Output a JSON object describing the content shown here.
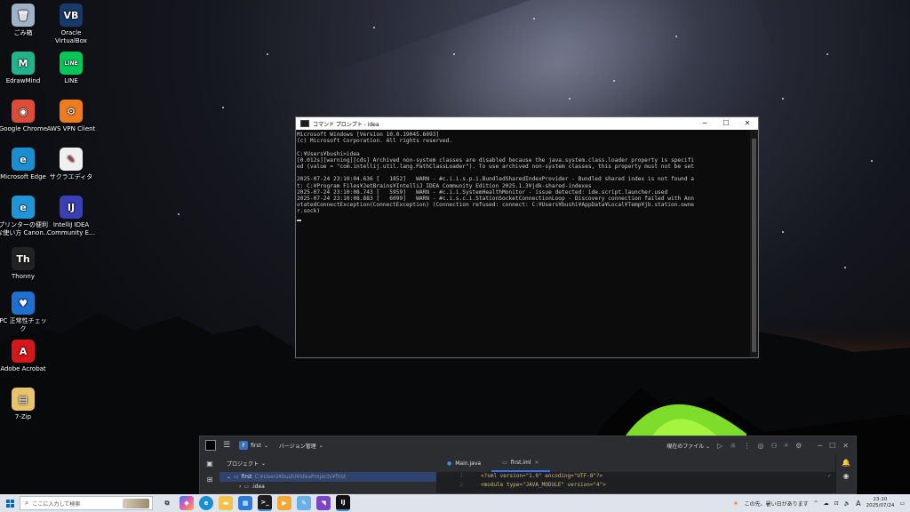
{
  "desktop_icons": [
    {
      "label": "ごみ箱",
      "color": "#9fb2c8",
      "glyph": "🗑"
    },
    {
      "label": "Oracle VirtualBox",
      "color": "#183a6b",
      "glyph": "VB"
    },
    {
      "label": "EdrawMind",
      "color": "#23b38a",
      "glyph": "M"
    },
    {
      "label": "LINE",
      "color": "#06c755",
      "glyph": "LINE"
    },
    {
      "label": "Google Chrome",
      "color": "#dd4b39",
      "glyph": "◉"
    },
    {
      "label": "AWS VPN Client",
      "color": "#ef7b20",
      "glyph": "⚙"
    },
    {
      "label": "Microsoft Edge",
      "color": "#1b8ecf",
      "glyph": "e"
    },
    {
      "label": "サクラエディタ",
      "color": "#f0f0f0",
      "glyph": "✎"
    },
    {
      "label": "プリンターの便利な使い方 Canon…",
      "color": "#1f95d8",
      "glyph": "e"
    },
    {
      "label": "IntelliJ IDEA Community E…",
      "color": "#3b3fb6",
      "glyph": "IJ"
    },
    {
      "label": "Thonny",
      "color": "#222222",
      "glyph": "Th"
    },
    {
      "label": "PC 正常性チェック",
      "color": "#1f6fd1",
      "glyph": "♥"
    },
    {
      "label": "Adobe Acrobat",
      "color": "#d4171b",
      "glyph": "A"
    },
    {
      "label": "7-Zip",
      "color": "#e8c36a",
      "glyph": "▤"
    }
  ],
  "cmd_window": {
    "title": "コマンド プロンプト - idea",
    "lines": [
      "Microsoft Windows [Version 10.0.19045.6093]",
      "(c) Microsoft Corporation. All rights reserved.",
      "",
      "C:¥Users¥bushi>idea",
      "[0.012s][warning][cds] Archived non-system classes are disabled because the java.system.class.loader property is specifi",
      "ed (value = \"com.intellij.util.lang.PathClassLoader\"). To use archived non-system classes, this property must not be set",
      "",
      "2025-07-24 23:10:04.636 [   1852]   WARN - #c.i.i.s.p.i.BundledSharedIndexProvider - Bundled shared index is not found a",
      "t: C:¥Program Files¥JetBrains¥IntelliJ IDEA Community Edition 2025.1.3¥jdk-shared-indexes",
      "2025-07-24 23:10:08.743 [   5959]   WARN - #c.i.i.SystemHealthMonitor - issue detected: ide.script.launcher.used",
      "2025-07-24 23:10:08.883 [   6099]   WARN - #c.i.s.c.i.StationSocketConnectionLoop - Discovery connection failed with Ann",
      "otatedConnectException(ConnectException) (Connection refused: connect: C:¥Users¥bushi¥AppData¥Local¥Temp¥jb.station.owne",
      "r.sock)"
    ]
  },
  "intellij": {
    "project_badge": "F",
    "project_name": "first",
    "vcs_label": "バージョン管理",
    "run_config": "現在のファイル",
    "panel_title": "プロジェクト",
    "tree_root": "first",
    "tree_root_path": "C:¥Users¥bushi¥IdeaProjects¥first",
    "tree_child": ".idea",
    "tabs": [
      "Main.java",
      "first.iml"
    ],
    "code_lines": [
      {
        "num": "1",
        "text": "<?xml version=\"1.0\" encoding=\"UTF-8\"?>"
      },
      {
        "num": "2",
        "text": "<module type=\"JAVA_MODULE\" version=\"4\">"
      }
    ]
  },
  "taskbar": {
    "search_placeholder": "ここに入力して検索",
    "weather": "この先、暑い日があります",
    "ime": "A",
    "time": "23:10",
    "date": "2025/07/24"
  }
}
